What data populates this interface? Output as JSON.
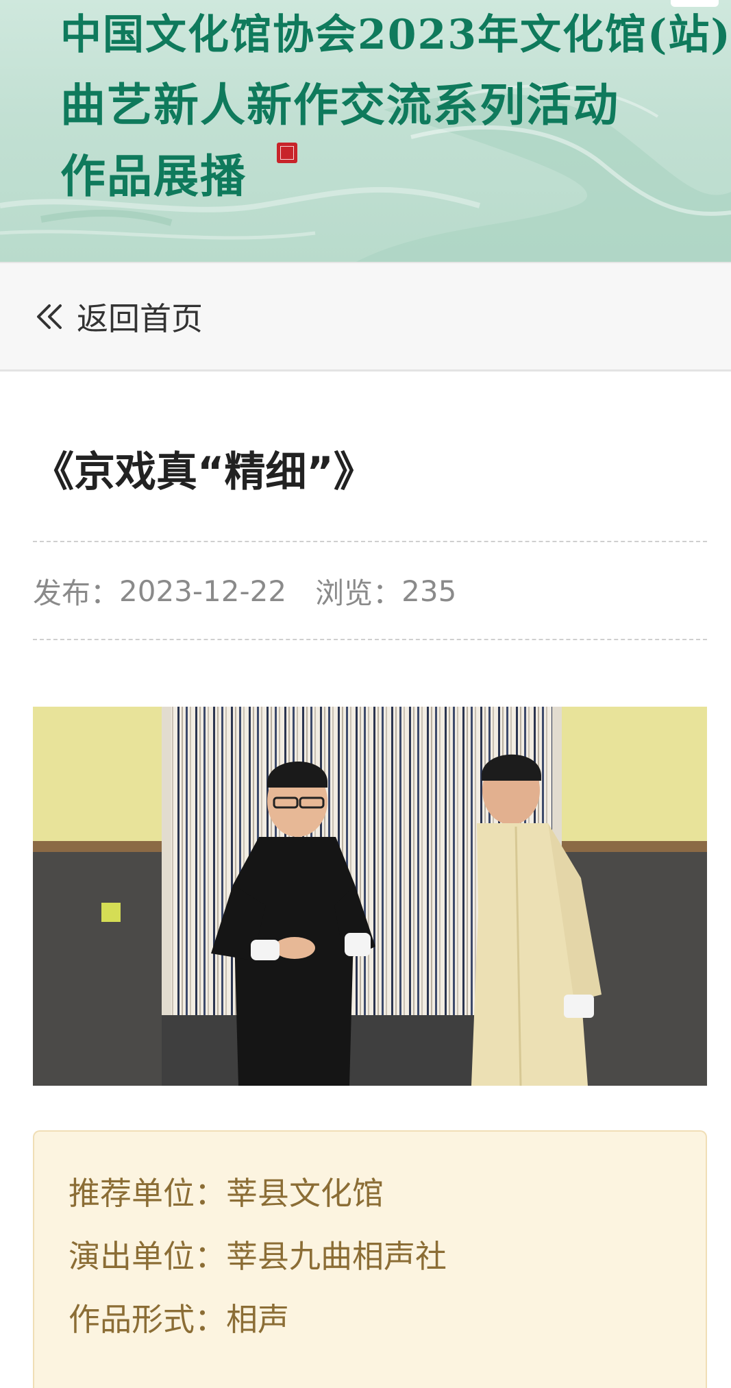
{
  "banner": {
    "line1": "中国文化馆协会2023年文化馆(站)",
    "line2": "曲艺新人新作交流系列活动",
    "line3": "作品展播"
  },
  "nav": {
    "back_icon": "double-chevron-left-icon",
    "back_label": "返回首页"
  },
  "article": {
    "title": "《京戏真“精细”》",
    "publish_label": "发布：",
    "publish_date": "2023-12-22",
    "views_label": "浏览：",
    "views_count": "235"
  },
  "info": {
    "rows": [
      {
        "label": "推荐单位：",
        "value": "莘县文化馆"
      },
      {
        "label": "演出单位：",
        "value": "莘县九曲相声社"
      },
      {
        "label": "作品形式：",
        "value": "相声"
      }
    ]
  },
  "colors": {
    "banner_text": "#0f7a5c",
    "info_text": "#8b6d35",
    "info_bg": "#fcf4e0"
  }
}
